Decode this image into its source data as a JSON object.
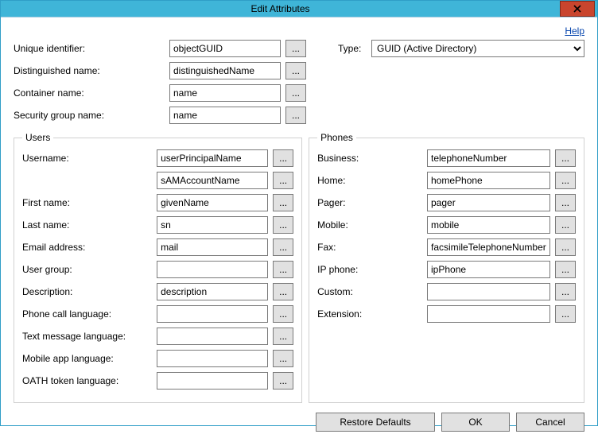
{
  "window": {
    "title": "Edit Attributes",
    "help": "Help"
  },
  "top": {
    "uid_label": "Unique identifier:",
    "uid_value": "objectGUID",
    "type_label": "Type:",
    "type_value": "GUID (Active Directory)",
    "dn_label": "Distinguished name:",
    "dn_value": "distinguishedName",
    "cn_label": "Container name:",
    "cn_value": "name",
    "sg_label": "Security group name:",
    "sg_value": "name"
  },
  "users": {
    "legend": "Users",
    "rows": [
      {
        "label": "Username:",
        "value": "userPrincipalName"
      },
      {
        "label": "",
        "value": "sAMAccountName"
      },
      {
        "label": "First name:",
        "value": "givenName"
      },
      {
        "label": "Last name:",
        "value": "sn"
      },
      {
        "label": "Email address:",
        "value": "mail"
      },
      {
        "label": "User group:",
        "value": ""
      },
      {
        "label": "Description:",
        "value": "description"
      },
      {
        "label": "Phone call language:",
        "value": ""
      },
      {
        "label": "Text message language:",
        "value": ""
      },
      {
        "label": "Mobile app language:",
        "value": ""
      },
      {
        "label": "OATH token language:",
        "value": ""
      }
    ]
  },
  "phones": {
    "legend": "Phones",
    "rows": [
      {
        "label": "Business:",
        "value": "telephoneNumber"
      },
      {
        "label": "Home:",
        "value": "homePhone"
      },
      {
        "label": "Pager:",
        "value": "pager"
      },
      {
        "label": "Mobile:",
        "value": "mobile"
      },
      {
        "label": "Fax:",
        "value": "facsimileTelephoneNumber"
      },
      {
        "label": "IP phone:",
        "value": "ipPhone"
      },
      {
        "label": "Custom:",
        "value": ""
      },
      {
        "label": "Extension:",
        "value": ""
      }
    ]
  },
  "buttons": {
    "restore": "Restore Defaults",
    "ok": "OK",
    "cancel": "Cancel"
  },
  "browse_glyph": "..."
}
